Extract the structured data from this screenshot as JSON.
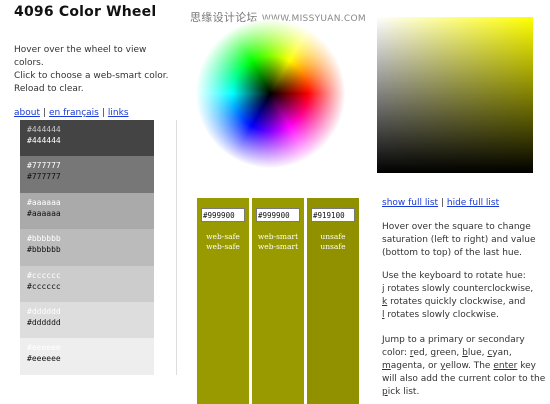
{
  "header": {
    "title": "4096 Color Wheel"
  },
  "intro": {
    "lines": [
      "Hover over the wheel to view",
      "colors.",
      "Click to choose a web-smart color.",
      "Reload to clear."
    ]
  },
  "links": {
    "about": "about",
    "francais": "en français",
    "links": "links",
    "sep": "|"
  },
  "watermark": {
    "cn": "思缘设计论坛",
    "url": "WWW.MISSYUAN.COM"
  },
  "swatches": [
    {
      "top": "#444444",
      "bottom": "#444444",
      "bg": "#444444",
      "top_color": "#c8c8c8",
      "bottom_color": "#ffffff"
    },
    {
      "top": "#777777",
      "bottom": "#777777",
      "bg": "#777777",
      "top_color": "#ffffff",
      "bottom_color": "#111111"
    },
    {
      "top": "#aaaaaa",
      "bottom": "#aaaaaa",
      "bg": "#aaaaaa",
      "top_color": "#ffffff",
      "bottom_color": "#111111"
    },
    {
      "top": "#bbbbbb",
      "bottom": "#bbbbbb",
      "bg": "#bbbbbb",
      "top_color": "#ffffff",
      "bottom_color": "#111111"
    },
    {
      "top": "#cccccc",
      "bottom": "#cccccc",
      "bg": "#cccccc",
      "top_color": "#ffffff",
      "bottom_color": "#111111"
    },
    {
      "top": "#dddddd",
      "bottom": "#dddddd",
      "bg": "#dddddd",
      "top_color": "#ffffff",
      "bottom_color": "#111111"
    },
    {
      "top": "#eeeeee",
      "bottom": "#eeeeee",
      "bg": "#eeeeee",
      "top_color": "#ffffff",
      "bottom_color": "#111111"
    }
  ],
  "pick_list": [
    {
      "value": "#999900",
      "line1": "web-safe",
      "line2": "web-safe",
      "bg": "#999900"
    },
    {
      "value": "#999900",
      "line1": "web-smart",
      "line2": "web-smart",
      "bg": "#999900"
    },
    {
      "value": "#919100",
      "line1": "unsafe",
      "line2": "unsafe",
      "bg": "#919100"
    }
  ],
  "full_links": {
    "show": "show full list",
    "sep": "|",
    "hide": "hide full list"
  },
  "help": {
    "p1": "Hover over the square to change saturation (left to right) and value (bottom to top) of the last hue.",
    "p2_intro": "Use the keyboard to rotate hue:",
    "p2_j": "j",
    "p2_j_text": " rotates slowly counterclockwise,",
    "p2_k": "k",
    "p2_k_text": " rotates quickly clockwise, and",
    "p2_l": "l",
    "p2_l_text": " rotates slowly clockwise.",
    "p3_a": "Jump to a primary or secondary color: ",
    "p3_r": "r",
    "p3_r_rest": "ed, ",
    "p3_g": "g",
    "p3_g_rest": "reen, ",
    "p3_b": "b",
    "p3_b_rest": "lue, ",
    "p3_c": "c",
    "p3_c_rest": "yan, ",
    "p3_m": "m",
    "p3_m_rest": "agenta, or ",
    "p3_y": "y",
    "p3_y_rest": "ellow. The ",
    "p3_enter": "enter",
    "p3_b2": " key will also add the current color to the ",
    "p3_p": "p",
    "p3_p_rest": "ick list."
  }
}
